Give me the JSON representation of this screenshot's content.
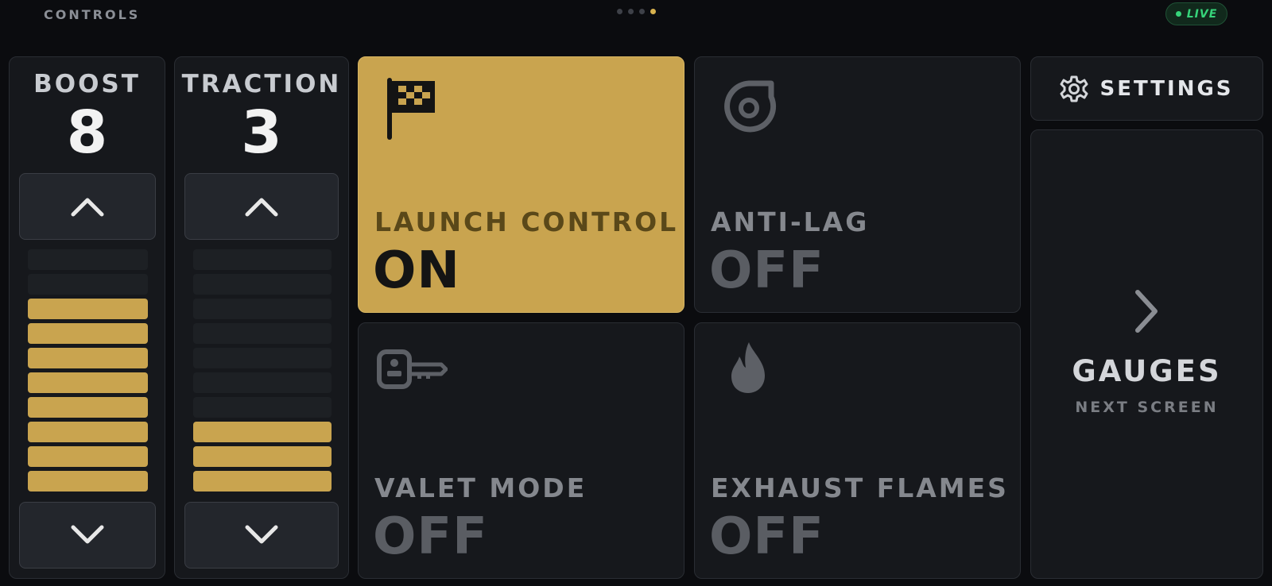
{
  "topbar": {
    "title": "CONTROLS",
    "page_count": 4,
    "active_page": 4,
    "live_label": "LIVE",
    "live_color": "#36d47a"
  },
  "boost": {
    "label": "BOOST",
    "value": "8",
    "level": 8,
    "max": 10,
    "up_icon": "chevron-up-icon",
    "down_icon": "chevron-down-icon"
  },
  "traction": {
    "label": "TRACTION",
    "value": "3",
    "level": 3,
    "max": 10,
    "up_icon": "chevron-up-icon",
    "down_icon": "chevron-down-icon"
  },
  "tiles": {
    "launch_control": {
      "label": "LAUNCH CONTROL",
      "state": "ON",
      "icon": "checkered-flag-icon",
      "active": true
    },
    "anti_lag": {
      "label": "ANTI-LAG",
      "state": "OFF",
      "icon": "turbo-icon",
      "active": false
    },
    "valet_mode": {
      "label": "VALET MODE",
      "state": "OFF",
      "icon": "key-fob-icon",
      "active": false
    },
    "exhaust_flames": {
      "label": "EXHAUST FLAMES",
      "state": "OFF",
      "icon": "flame-icon",
      "active": false
    }
  },
  "settings": {
    "label": "SETTINGS",
    "icon": "gear-icon"
  },
  "gauges": {
    "label": "GAUGES",
    "sublabel": "NEXT SCREEN",
    "icon": "chevron-right-icon"
  },
  "colors": {
    "accent": "#c9a44f",
    "background": "#0b0c0f",
    "panel": "#16181c",
    "live_green": "#36d47a"
  }
}
